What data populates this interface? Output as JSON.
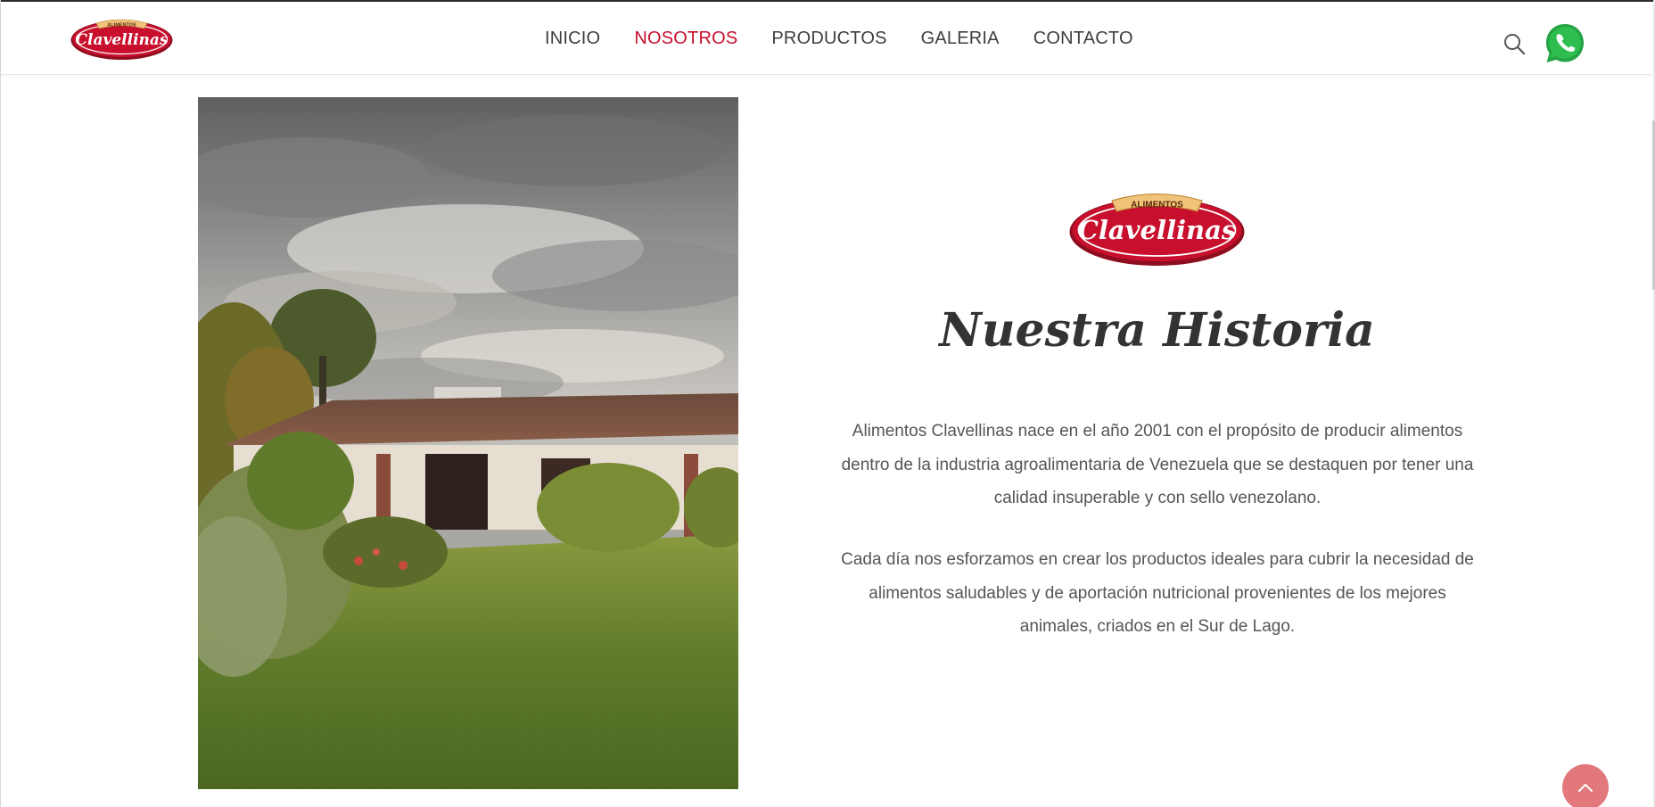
{
  "brand": {
    "logo_top": "ALIMENTOS",
    "logo_name": "Clavellinas",
    "color_red": "#c8102e",
    "color_gold": "#e8b866"
  },
  "nav": {
    "items": [
      {
        "label": "INICIO",
        "active": false
      },
      {
        "label": "NOSOTROS",
        "active": true
      },
      {
        "label": "PRODUCTOS",
        "active": false
      },
      {
        "label": "GALERIA",
        "active": false
      },
      {
        "label": "CONTACTO",
        "active": false
      }
    ]
  },
  "header_icons": {
    "search": "search-icon",
    "whatsapp": "whatsapp-icon"
  },
  "section": {
    "title": "Nuestra Historia",
    "paragraph_1": "Alimentos Clavellinas nace en el año 2001 con el propósito de producir alimentos dentro de la industria agroalimentaria de Venezuela que se destaquen por tener una calidad insuperable y con sello venezolano.",
    "paragraph_2": "Cada día nos esforzamos en crear los productos ideales para cubrir la necesidad de alimentos saludables y de aportación nutricional provenientes de los mejores animales, criados en el Sur de Lago."
  },
  "scroll_top": {
    "icon": "chevron-up-icon"
  }
}
